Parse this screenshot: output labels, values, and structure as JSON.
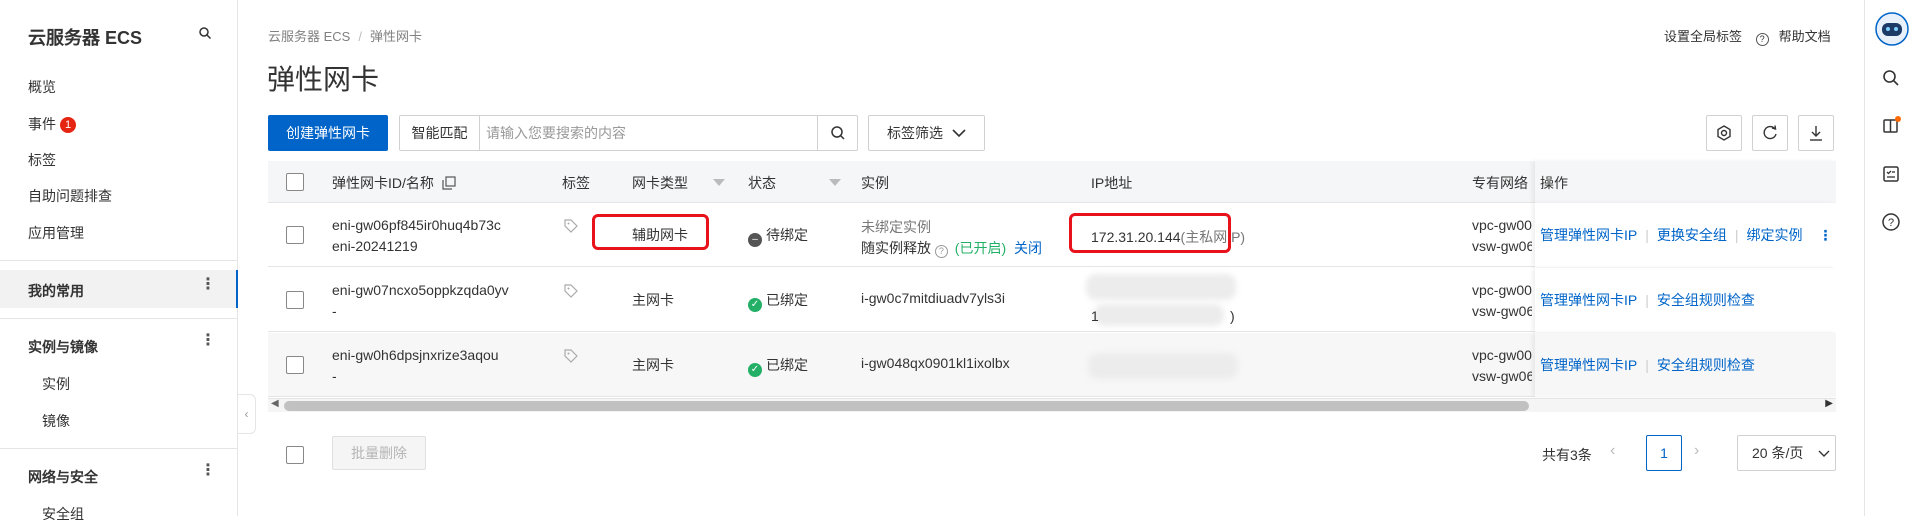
{
  "sidebar": {
    "title": "云服务器 ECS",
    "items": [
      {
        "label": "概览"
      },
      {
        "label": "事件",
        "badge": "1"
      },
      {
        "label": "标签"
      },
      {
        "label": "自助问题排查"
      },
      {
        "label": "应用管理"
      }
    ],
    "favorites_label": "我的常用",
    "group_instances": "实例与镜像",
    "sub_instances": [
      "实例",
      "镜像"
    ],
    "group_network": "网络与安全",
    "sub_network": [
      "安全组"
    ]
  },
  "header": {
    "breadcrumb": [
      "云服务器 ECS",
      "弹性网卡"
    ],
    "title": "弹性网卡",
    "global_tags": "设置全局标签",
    "help_docs": "帮助文档"
  },
  "toolbar": {
    "create_label": "创建弹性网卡",
    "search_type": "智能匹配",
    "search_placeholder": "请输入您要搜索的内容",
    "tag_filter": "标签筛选"
  },
  "table": {
    "columns": [
      "弹性网卡ID/名称",
      "标签",
      "网卡类型",
      "状态",
      "实例",
      "IP地址",
      "专有网络",
      "操作"
    ],
    "rows": [
      {
        "id": "eni-gw06pf845ir0huq4b73c",
        "name": "eni-20241219",
        "type": "辅助网卡",
        "status": "待绑定",
        "instance_line1": "未绑定实例",
        "instance_line2": "随实例释放",
        "instance_enabled": "(已开启)",
        "instance_close": "关闭",
        "ip": "172.31.20.144",
        "ip_note": "(主私网IP)",
        "vpc": "vpc-gw00",
        "vsw": "vsw-gw06",
        "ops": [
          "管理弹性网卡IP",
          "更换安全组",
          "绑定实例"
        ]
      },
      {
        "id": "eni-gw07ncxo5oppkzqda0yv",
        "name": "-",
        "type": "主网卡",
        "status": "已绑定",
        "instance": "i-gw0c7mitdiuadv7yls3i",
        "ip_partial": "1",
        "ip_close": ")",
        "vpc": "vpc-gw00",
        "vsw": "vsw-gw06",
        "ops": [
          "管理弹性网卡IP",
          "安全组规则检查"
        ]
      },
      {
        "id": "eni-gw0h6dpsjnxrize3aqou",
        "name": "-",
        "type": "主网卡",
        "status": "已绑定",
        "instance": "i-gw048qx0901kl1ixolbx",
        "vpc": "vpc-gw00",
        "vsw": "vsw-gw06",
        "ops": [
          "管理弹性网卡IP",
          "安全组规则检查"
        ]
      }
    ]
  },
  "footer": {
    "bulk_delete": "批量删除",
    "total": "共有3条",
    "current_page": "1",
    "page_size": "20 条/页"
  },
  "colors": {
    "primary": "#0064c8",
    "success": "#23b066",
    "highlight_box": "#e8121a",
    "badge": "#e62412"
  },
  "icons": [
    "search-icon",
    "settings-icon",
    "refresh-icon",
    "download-icon",
    "tag-icon",
    "copy-icon",
    "filter-icon",
    "more-icon",
    "assistant-avatar-icon",
    "book-icon",
    "checklist-icon",
    "help-icon"
  ]
}
